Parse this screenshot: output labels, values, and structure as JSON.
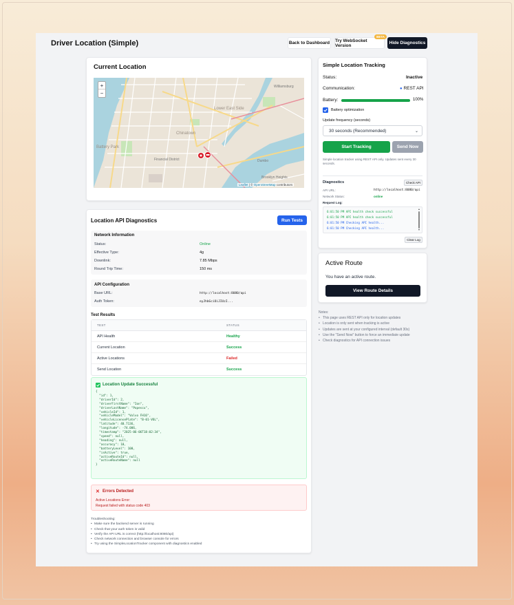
{
  "header": {
    "title": "Driver Location (Simple)",
    "back_label": "Back to Dashboard",
    "websocket_label": "Try WebSocket Version",
    "beta_label": "BETA",
    "hide_diag_label": "Hide Diagnostics"
  },
  "map_card": {
    "title": "Current Location",
    "zoom_in": "+",
    "zoom_out": "−",
    "attribution_leaflet": "Leaflet",
    "attribution_sep": " | © ",
    "attribution_osm": "OpenStreetMap",
    "attribution_tail": " contributors",
    "labels": [
      "Williamsburg",
      "Lower East Side",
      "Battery Park",
      "Chinatown",
      "Financial District",
      "Dumbo",
      "Brooklyn Heights"
    ]
  },
  "api_diag": {
    "title": "Location API Diagnostics",
    "run_tests_label": "Run Tests",
    "network": {
      "title": "Network Information",
      "rows": [
        {
          "label": "Status:",
          "value": "Online"
        },
        {
          "label": "Effective Type:",
          "value": "4g"
        },
        {
          "label": "Downlink:",
          "value": "7.85 Mbps"
        },
        {
          "label": "Round Trip Time:",
          "value": "150 ms"
        }
      ]
    },
    "config": {
      "title": "API Configuration",
      "rows": [
        {
          "label": "Base URL:",
          "value": "http://localhost:8080/api"
        },
        {
          "label": "Auth Token:",
          "value": "eyJhbGciOiJIUzI..."
        }
      ]
    },
    "tests": {
      "title": "Test Results",
      "col_test": "TEST",
      "col_status": "STATUS",
      "rows": [
        {
          "test": "API Health",
          "status": "Healthy"
        },
        {
          "test": "Current Location",
          "status": "Success"
        },
        {
          "test": "Active Locations",
          "status": "Failed"
        },
        {
          "test": "Send Location",
          "status": "Success"
        }
      ]
    },
    "success": {
      "title": "Location Update Successful",
      "json": "{\n  \"id\": 1,\n  \"driverId\": 2,\n  \"driverFirstName\": \"Ion\",\n  \"driverLastName\": \"Popescu\",\n  \"vehicleId\": 1,\n  \"vehicleModel\": \"Volvo FH16\",\n  \"vehicleLicensePlate\": \"B-01-VOL\",\n  \"latitude\": 40.7136,\n  \"longitude\": -74.006,\n  \"timestamp\": \"2025-06-06T18:02:34\",\n  \"speed\": null,\n  \"heading\": null,\n  \"accuracy\": 10,\n  \"batteryLevel\": 100,\n  \"isActive\": true,\n  \"activeRouteId\": null,\n  \"activeRouteName\": null\n}"
    },
    "errors": {
      "title": "Errors Detected",
      "line1": "Active Locations Error:",
      "line2": "Request failed with status code 403"
    },
    "troubleshooting": {
      "title": "Troubleshooting:",
      "items": [
        "Make sure the backend server is running",
        "Check that your auth token is valid",
        "Verify the API URL is correct (http://localhost:8080/api)",
        "Check network connection and browser console for errors",
        "Try using the SimpleLocationTracker component with diagnostics enabled"
      ]
    }
  },
  "tracker": {
    "title": "Simple Location Tracking",
    "status_label": "Status:",
    "status_value": "Inactive",
    "comm_label": "Communication:",
    "comm_value": "REST API",
    "battery_label": "Battery:",
    "battery_value": "100%",
    "battery_level": 1.0,
    "battery_opt_label": "Battery optimization",
    "freq_label": "Update frequency (seconds)",
    "freq_value": "30 seconds (Recommended)",
    "start_label": "Start Tracking",
    "send_label": "Send Now",
    "description": "Simple location tracker using REST API only. Updates sent every 30 seconds.",
    "diag": {
      "title": "Diagnostics",
      "check_api_label": "Check API",
      "api_url_label": "API URL:",
      "api_url_value": "http://localhost:8080/api",
      "network_label": "Network Status:",
      "network_value": "online",
      "log_label": "Request Log:",
      "log": [
        {
          "time": "6:01:50 PM",
          "msg": "API health check successful"
        },
        {
          "time": "6:01:50 PM",
          "msg": "API health check successful"
        },
        {
          "time": "6:01:50 PM",
          "msg": "Checking API health..."
        },
        {
          "time": "6:01:50 PM",
          "msg": "Checking API health..."
        }
      ],
      "clear_label": "Clear Log"
    }
  },
  "route": {
    "title": "Active Route",
    "text": "You have an active route.",
    "button_label": "View Route Details"
  },
  "notes": {
    "title": "Notes:",
    "items": [
      "This page uses REST API only for location updates",
      "Location is only sent when tracking is active",
      "Updates are sent at your configured interval (default 30s)",
      "Use the \"Send Now\" button to force an immediate update",
      "Check diagnostics for API connection issues"
    ]
  },
  "colors": {
    "primary_blue": "#2563eb",
    "success_green": "#16a34a",
    "danger_red": "#dc2626",
    "dark": "#111827"
  }
}
